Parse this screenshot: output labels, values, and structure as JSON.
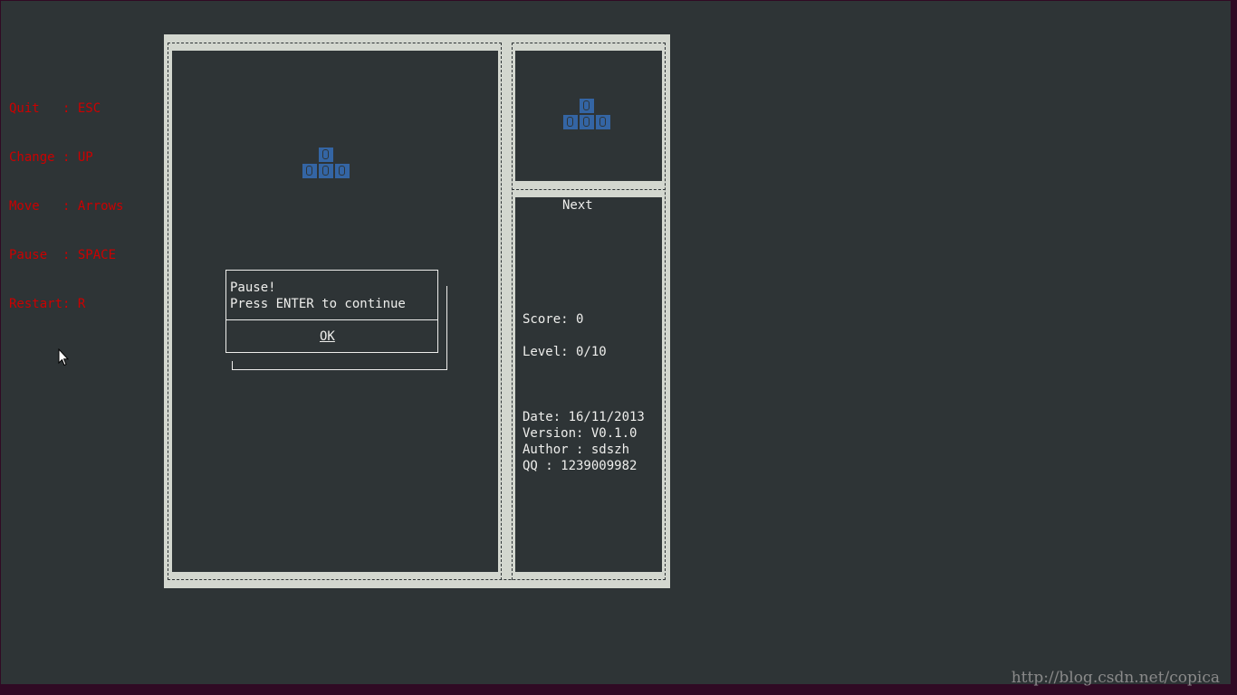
{
  "help": {
    "lines": [
      "Quit   : ESC",
      "Change : UP",
      "Move   : Arrows",
      "Pause  : SPACE",
      "Restart: R"
    ]
  },
  "next_panel": {
    "label": "Next"
  },
  "stats": {
    "score": "Score: 0",
    "level": "Level: 0/10"
  },
  "info": {
    "date": "Date: 16/11/2013",
    "version": "Version: V0.1.0",
    "author": "Author : sdszh",
    "qq": "QQ : 1239009982"
  },
  "dialog": {
    "title": "Pause!",
    "message": "Press ENTER to continue",
    "ok_label": "OK"
  },
  "watermark": "http://blog.csdn.net/copica",
  "colors": {
    "background": "#2e3436",
    "frame": "#d3d7cf",
    "help_text": "#cc0000",
    "block": "#3465a4",
    "text": "#eeeeec"
  },
  "pieces": {
    "current": "T-piece",
    "next": "T-piece"
  }
}
